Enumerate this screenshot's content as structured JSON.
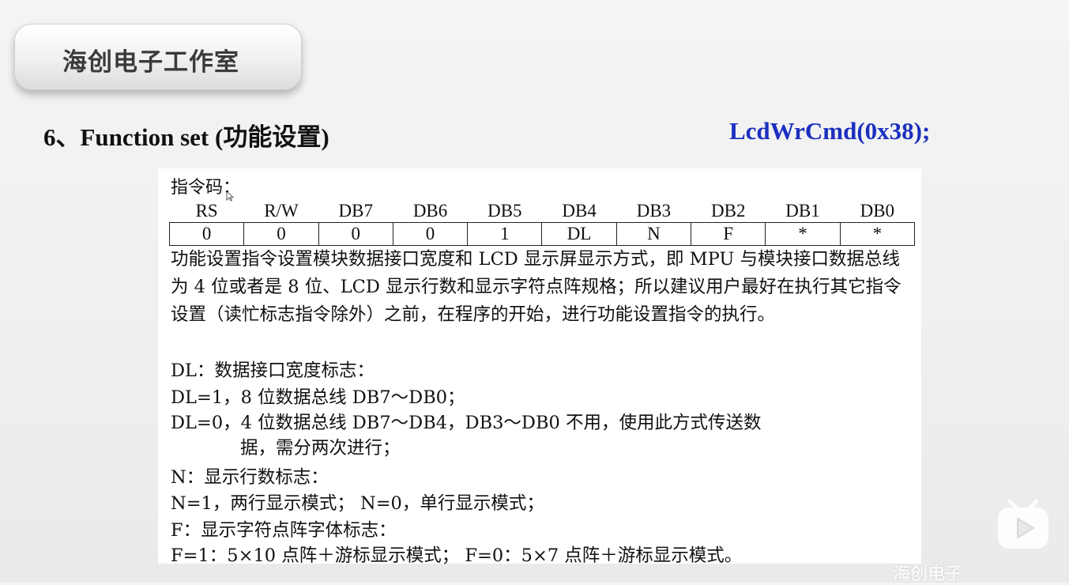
{
  "brand": {
    "name": "海创电子工作室"
  },
  "heading": {
    "title": "6、Function set (功能设置)",
    "code": "LcdWrCmd(0x38);"
  },
  "doc": {
    "caption": "指令码：",
    "bit_headers": [
      "RS",
      "R/W",
      "DB7",
      "DB6",
      "DB5",
      "DB4",
      "DB3",
      "DB2",
      "DB1",
      "DB0"
    ],
    "bit_values": [
      "0",
      "0",
      "0",
      "0",
      "1",
      "DL",
      "N",
      "F",
      "*",
      "*"
    ],
    "description": "功能设置指令设置模块数据接口宽度和 LCD 显示屏显示方式，即 MPU 与模块接口数据总线为 4 位或者是 8 位、LCD 显示行数和显示字符点阵规格；所以建议用户最好在执行其它指令设置（读忙标志指令除外）之前，在程序的开始，进行功能设置指令的执行。",
    "dl_title": "DL：数据接口宽度标志：",
    "dl1": "DL=1，8 位数据总线 DB7～DB0；",
    "dl0_a": "DL=0，4 位数据总线 DB7～DB4，DB3～DB0 不用，使用此方式传送数",
    "dl0_b": "据，需分两次进行；",
    "n_title": "N：显示行数标志：",
    "n_desc": "N=1，两行显示模式；  N=0，单行显示模式；",
    "f_title": "F：显示字符点阵字体标志：",
    "f_desc": "F=1：5×10 点阵＋游标显示模式；  F=0：5×7 点阵＋游标显示模式。"
  },
  "overlay": {
    "watermark": "海创电子"
  },
  "colors": {
    "code": "#1c2fbf",
    "background": "#efefef"
  }
}
